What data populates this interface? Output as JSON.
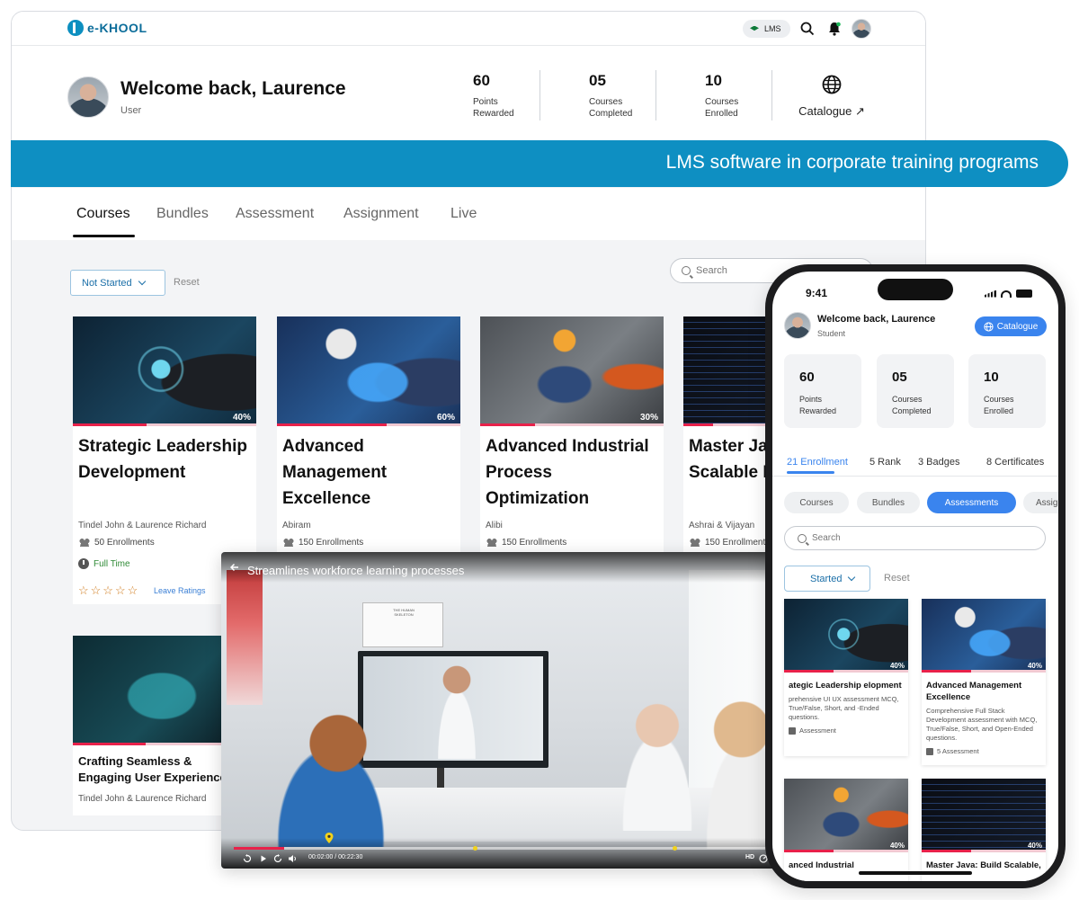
{
  "app": {
    "logo_text": "e-KHOOL",
    "lms_badge": "LMS",
    "welcome": "Welcome back, Laurence",
    "role": "User",
    "stats": [
      {
        "value": "60",
        "label": "Points Rewarded"
      },
      {
        "value": "05",
        "label": "Courses Completed"
      },
      {
        "value": "10",
        "label": "Courses Enrolled"
      }
    ],
    "catalogue": "Catalogue ↗",
    "tabs": [
      "Courses",
      "Bundles",
      "Assessment",
      "Assignment",
      "Live"
    ],
    "filter": {
      "selected": "Not Started",
      "reset": "Reset",
      "search_placeholder": "Search"
    }
  },
  "banner": {
    "text": "LMS software in corporate training programs"
  },
  "courses": [
    {
      "title": "Strategic Leadership Development",
      "progress": 40,
      "progress_label": "40%",
      "authors": "Tindel John & Laurence Richard",
      "enrollments": "50 Enrollments",
      "time": "Full Time",
      "rating_label": "Leave Ratings",
      "stars": "☆☆☆☆☆"
    },
    {
      "title": "Advanced Management Excellence",
      "progress": 60,
      "progress_label": "60%",
      "authors": "Abiram",
      "enrollments": "150 Enrollments"
    },
    {
      "title": "Advanced Industrial Process Optimization",
      "progress": 30,
      "progress_label": "30%",
      "authors": "Alibi",
      "enrollments": "150 Enrollments"
    },
    {
      "title": "Master Java: Scalable Perform..",
      "authors": "Ashrai & Vijayan",
      "enrollments": "150 Enrollments"
    }
  ],
  "course_second_row": {
    "title": "Crafting Seamless & Engaging User Experiences",
    "authors": "Tindel John & Laurence Richard",
    "progress": 45
  },
  "video": {
    "title": "Streamlines workforce learning processes",
    "time": "00:02:00 / 00:22:30",
    "progress": 9,
    "quality": "HD",
    "scene_text": "THE HUMAN SKELETON"
  },
  "phone": {
    "clock": "9:41",
    "welcome": "Welcome back, Laurence",
    "role": "Student",
    "catalogue": "Catalogue",
    "stats": [
      {
        "value": "60",
        "label": "Points Rewarded"
      },
      {
        "value": "05",
        "label": "Courses Completed"
      },
      {
        "value": "10",
        "label": "Courses Enrolled"
      }
    ],
    "tabs": [
      "21 Enrollment",
      "5 Rank",
      "3 Badges",
      "8 Certificates"
    ],
    "chips": [
      "Courses",
      "Bundles",
      "Assessments",
      "Assig"
    ],
    "search_placeholder": "Search",
    "filter_selected": "Started",
    "reset": "Reset",
    "cards": [
      {
        "title": "ategic Leadership elopment",
        "desc": "prehensive UI UX assessment MCQ, True/False, Short, and -Ended questions.",
        "foot": "Assessment",
        "progress_label": "40%"
      },
      {
        "title": "Advanced Management Excellence",
        "desc": "Comprehensive Full Stack Development assessment with MCQ, True/False, Short, and Open-Ended questions.",
        "foot": "5 Assessment",
        "progress_label": "40%"
      },
      {
        "title": "anced Industrial",
        "progress_label": "40%"
      },
      {
        "title": "Master Java: Build Scalable,",
        "progress_label": "40%"
      }
    ]
  },
  "colors": {
    "brand": "#0e8fc2",
    "accent_blue": "#3a84ee",
    "progress_red": "#e8214a",
    "full_time_green": "#2f8a36",
    "star_orange": "#d07a1b"
  }
}
